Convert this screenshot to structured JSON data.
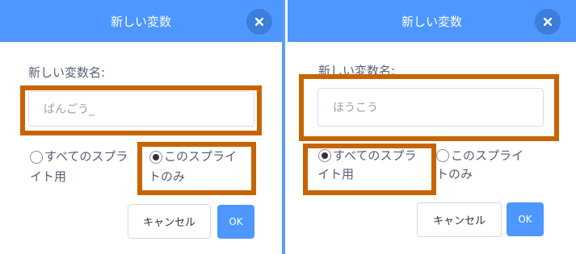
{
  "dialogs": [
    {
      "title": "新しい変数",
      "name_label": "新しい変数名:",
      "input_value": "ばんごう_",
      "option_all_sprites_line1": "すべてのスプラ",
      "option_all_sprites_line2": "イト用",
      "option_this_sprite_line1": "このスプライ",
      "option_this_sprite_line2": "トのみ",
      "selected_option": "this_sprite",
      "cancel_label": "キャンセル",
      "ok_label": "OK"
    },
    {
      "title": "新しい変数",
      "name_label": "新しい変数名:",
      "input_value": "ほうこう",
      "option_all_sprites_line1": "すべてのスプラ",
      "option_all_sprites_line2": "イト用",
      "option_this_sprite_line1": "このスプライ",
      "option_this_sprite_line2": "トのみ",
      "selected_option": "all_sprites",
      "cancel_label": "キャンセル",
      "ok_label": "OK"
    }
  ],
  "colors": {
    "header": "#4d97ff",
    "close_button": "#3c7ed8",
    "highlight_box": "#c86400",
    "divider": "#5b9ef5",
    "text": "#575e75"
  },
  "icons": {
    "close": "close-icon"
  }
}
